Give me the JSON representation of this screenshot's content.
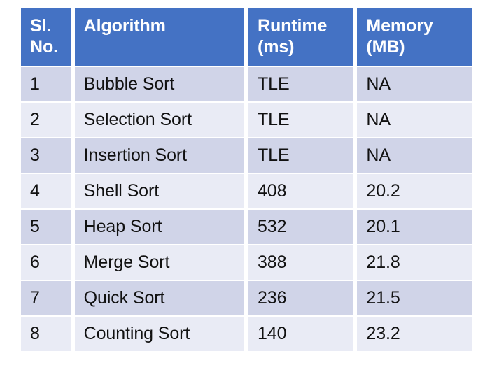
{
  "table": {
    "columns": [
      {
        "key": "sl_no",
        "label_lines": [
          "Sl.",
          "No."
        ]
      },
      {
        "key": "algorithm",
        "label_lines": [
          "Algorithm",
          ""
        ]
      },
      {
        "key": "runtime",
        "label_lines": [
          "Runtime",
          "(ms)"
        ]
      },
      {
        "key": "memory",
        "label_lines": [
          "Memory",
          "(MB)"
        ]
      }
    ],
    "rows": [
      {
        "sl_no": "1",
        "algorithm": "Bubble Sort",
        "runtime": "TLE",
        "memory": "NA"
      },
      {
        "sl_no": "2",
        "algorithm": "Selection Sort",
        "runtime": "TLE",
        "memory": "NA"
      },
      {
        "sl_no": "3",
        "algorithm": "Insertion Sort",
        "runtime": "TLE",
        "memory": "NA"
      },
      {
        "sl_no": "4",
        "algorithm": "Shell Sort",
        "runtime": "408",
        "memory": "20.2"
      },
      {
        "sl_no": "5",
        "algorithm": "Heap Sort",
        "runtime": "532",
        "memory": "20.1"
      },
      {
        "sl_no": "6",
        "algorithm": "Merge Sort",
        "runtime": "388",
        "memory": "21.8"
      },
      {
        "sl_no": "7",
        "algorithm": "Quick Sort",
        "runtime": "236",
        "memory": "21.5"
      },
      {
        "sl_no": "8",
        "algorithm": "Counting Sort",
        "runtime": "140",
        "memory": "23.2"
      }
    ],
    "colors": {
      "header_bg": "#4472C4",
      "header_text": "#FFFFFF",
      "band_dark": "#D0D4E8",
      "band_light": "#E9EBF5",
      "body_text": "#111111",
      "page_bg": "#FFFFFF"
    }
  }
}
